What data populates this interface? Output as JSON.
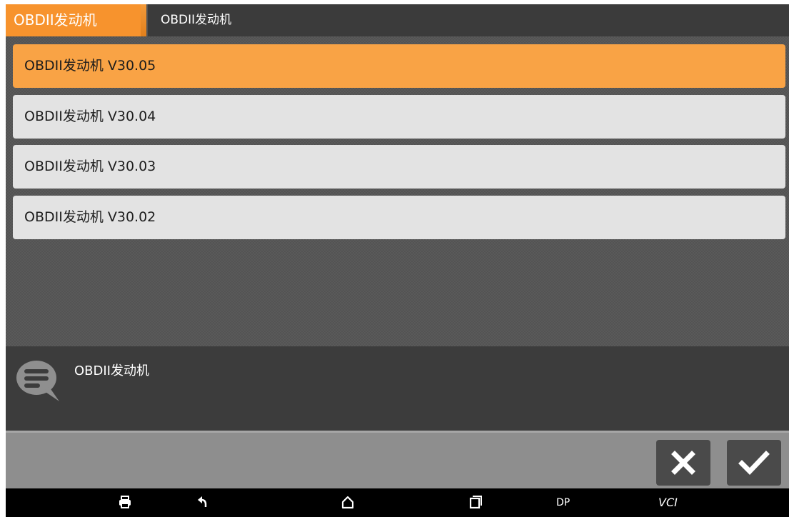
{
  "header": {
    "active_crumb": "OBDII发动机",
    "next_crumb": "OBDII发动机"
  },
  "list": {
    "items": [
      {
        "label": "OBDII发动机  V30.05",
        "selected": true
      },
      {
        "label": "OBDII发动机  V30.04",
        "selected": false
      },
      {
        "label": "OBDII发动机  V30.03",
        "selected": false
      },
      {
        "label": "OBDII发动机  V30.02",
        "selected": false
      }
    ]
  },
  "message": {
    "icon": "chat-bubble-icon",
    "text": "OBDII发动机"
  },
  "actions": {
    "cancel_icon": "close-icon",
    "confirm_icon": "check-icon"
  },
  "navbar": {
    "icons": [
      "printer-icon",
      "back-icon",
      "home-icon",
      "recent-apps-icon"
    ],
    "dp_label": "DP",
    "vci_label": "VCI"
  },
  "colors": {
    "accent": "#f7932d",
    "selected_item": "#f9a345",
    "item_bg": "#e3e3e3",
    "panel": "#3c3c3c",
    "action_bar": "#8e8e8e"
  }
}
